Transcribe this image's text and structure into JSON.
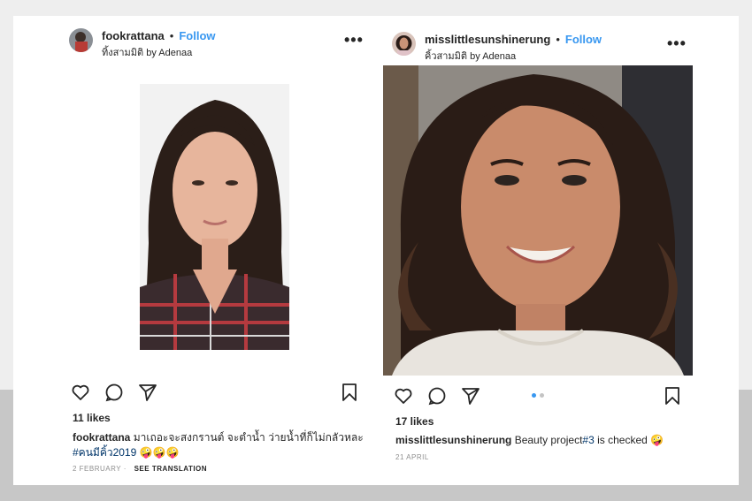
{
  "post1": {
    "username": "fookrattana",
    "follow_label": "Follow",
    "location": "ทิ้งสามมิติ by Adenaa",
    "likes": "11 likes",
    "caption_user": "fookrattana",
    "caption_text": "มาเถอะจะสงกรานต์ จะตำน้ำ ว่ายน้ำที่ก็ไม่กลัวหละ",
    "hashtag": "#คนมีคิ้ว2019",
    "emojis": "🤪🤪🤪",
    "date": "2 FEBRUARY",
    "translation_label": "SEE TRANSLATION"
  },
  "post2": {
    "username": "misslittlesunshinerung",
    "follow_label": "Follow",
    "location": "คิ้วสามมิติ by Adenaa",
    "likes": "17 likes",
    "caption_user": "misslittlesunshinerung",
    "caption_text": "Beauty project",
    "hashtag": "#3",
    "caption_tail": "is checked",
    "emoji": "🤪",
    "date": "21 APRIL",
    "carousel_index": 1,
    "carousel_count": 2
  },
  "icons": [
    "heart-icon",
    "comment-icon",
    "share-icon",
    "bookmark-icon",
    "more-options-icon"
  ],
  "colors": {
    "follow": "#3897f0",
    "background_band": "#c7c7c7",
    "page": "#eeeeee"
  }
}
